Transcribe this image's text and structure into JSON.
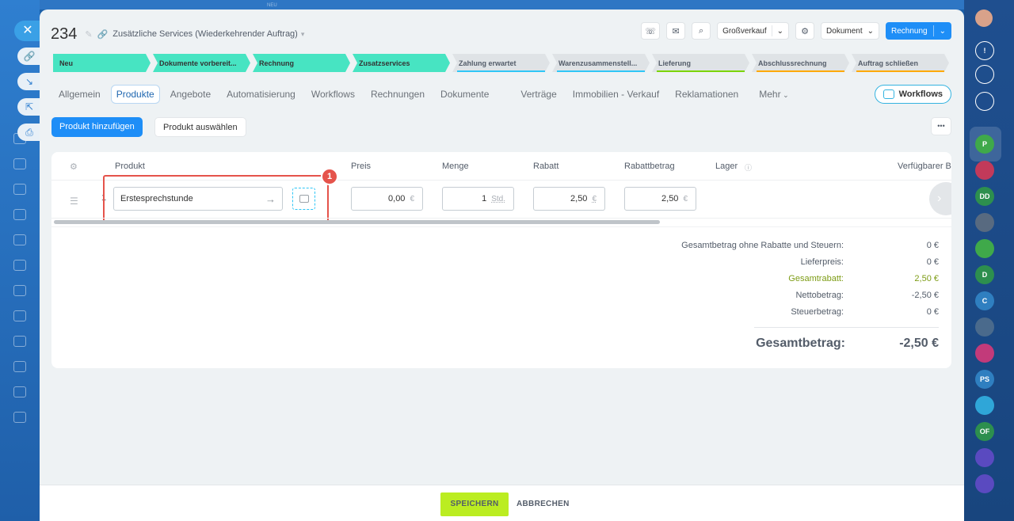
{
  "backdrop": {
    "top_text": "NEU"
  },
  "header": {
    "title": "234",
    "subtitle": "Zusätzliche Services (Wiederkehrender Auftrag)"
  },
  "toolbar": {
    "price_type": "Großverkauf",
    "document_label": "Dokument",
    "invoice_label": "Rechnung"
  },
  "stages": [
    {
      "label": "Neu",
      "state": "active",
      "underline": ""
    },
    {
      "label": "Dokumente vorbereit...",
      "state": "active",
      "underline": ""
    },
    {
      "label": "Rechnung",
      "state": "active",
      "underline": ""
    },
    {
      "label": "Zusatzservices",
      "state": "active",
      "underline": ""
    },
    {
      "label": "Zahlung erwartet",
      "state": "inactive",
      "underline": "#2fc6f6"
    },
    {
      "label": "Warenzusammenstell...",
      "state": "inactive",
      "underline": "#2fc6f6"
    },
    {
      "label": "Lieferung",
      "state": "inactive",
      "underline": "#7bd500"
    },
    {
      "label": "Abschlussrechnung",
      "state": "inactive",
      "underline": "#ffa900"
    },
    {
      "label": "Auftrag schließen",
      "state": "inactive",
      "underline": "#ffa900"
    }
  ],
  "tabs": [
    {
      "label": "Allgemein",
      "active": false
    },
    {
      "label": "Produkte",
      "active": true
    },
    {
      "label": "Angebote",
      "active": false
    },
    {
      "label": "Automatisierung",
      "active": false
    },
    {
      "label": "Workflows",
      "active": false
    },
    {
      "label": "Rechnungen",
      "active": false
    },
    {
      "label": "Dokumente",
      "active": false
    },
    {
      "label": "Verträge",
      "active": false
    },
    {
      "label": "Immobilien - Verkauf",
      "active": false
    },
    {
      "label": "Reklamationen",
      "active": false
    },
    {
      "label": "Mehr",
      "active": false
    }
  ],
  "workflows_button": "Workflows",
  "actions": {
    "add_product": "Produkt hinzufügen",
    "select_product": "Produkt auswählen"
  },
  "table": {
    "headers": {
      "product": "Produkt",
      "price": "Preis",
      "quantity": "Menge",
      "discount": "Rabatt",
      "discount_amount": "Rabattbetrag",
      "stock": "Lager",
      "available": "Verfügbarer B"
    },
    "row": {
      "number": "1",
      "name": "Erstesprechstunde",
      "price": "0,00",
      "price_currency": "€",
      "quantity": "1",
      "quantity_unit": "Std.",
      "discount": "2,50",
      "discount_currency": "€",
      "discount_amount": "2,50",
      "discount_amount_currency": "€"
    },
    "callout_badge": "1"
  },
  "totals": {
    "rows": [
      {
        "label": "Gesamtbetrag ohne Rabatte und Steuern:",
        "value": "0 €"
      },
      {
        "label": "Lieferpreis:",
        "value": "0 €"
      },
      {
        "label": "Gesamtrabatt:",
        "value": "2,50 €"
      },
      {
        "label": "Nettobetrag:",
        "value": "-2,50 €"
      },
      {
        "label": "Steuerbetrag:",
        "value": "0 €"
      }
    ],
    "grand_label": "Gesamtbetrag:",
    "grand_value": "-2,50 €"
  },
  "footer": {
    "save": "SPEICHERN",
    "cancel": "ABBRECHEN"
  },
  "rail": [
    {
      "text": "P",
      "color": "#3fa94a"
    },
    {
      "text": "",
      "color": "#c23a5a"
    },
    {
      "text": "DD",
      "color": "#2d8f4e"
    },
    {
      "text": "",
      "color": "#586a80"
    },
    {
      "text": "",
      "color": "#3fa94a"
    },
    {
      "text": "D",
      "color": "#2d8f4e"
    },
    {
      "text": "C",
      "color": "#2f7fc0"
    },
    {
      "text": "",
      "color": "#4a6a8c"
    },
    {
      "text": "",
      "color": "#c23a7a"
    },
    {
      "text": "PS",
      "color": "#2f7fc0"
    },
    {
      "text": "",
      "color": "#2fa6d8"
    },
    {
      "text": "OF",
      "color": "#2d8f4e"
    },
    {
      "text": "",
      "color": "#5a4ac0"
    },
    {
      "text": "",
      "color": "#5a4ac0"
    }
  ]
}
